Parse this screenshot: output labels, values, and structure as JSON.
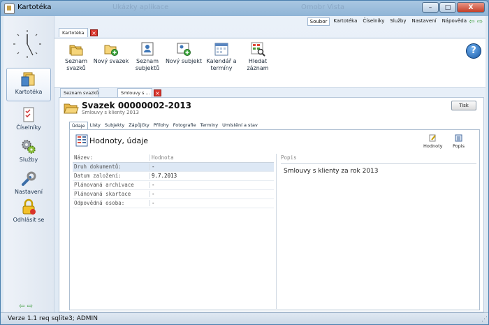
{
  "window": {
    "title": "Kartotéka",
    "ghost_title_left": "Ukázky aplikace",
    "ghost_title_right": "Omobr Vista",
    "min_label": "–",
    "max_label": "□",
    "close_label": "X"
  },
  "sidebar": {
    "items": [
      {
        "label": "Kartotéka",
        "icon": "folder-icon"
      },
      {
        "label": "Číselníky",
        "icon": "checklist-icon"
      },
      {
        "label": "Služby",
        "icon": "gears-icon"
      },
      {
        "label": "Nastavení",
        "icon": "wrench-icon"
      },
      {
        "label": "Odhlásit se",
        "icon": "lock-icon"
      }
    ],
    "arrows": "⇦ ⇨"
  },
  "menubar": {
    "items": [
      "Soubor",
      "Kartotéka",
      "Číselníky",
      "Služby",
      "Nastavení",
      "Nápověda"
    ],
    "arrows": "⇦ ⇨"
  },
  "top_tab": {
    "label": "Kartotéka",
    "close": "×"
  },
  "ribbon": {
    "buttons": [
      {
        "label": "Seznam svazků",
        "icon": "folders-icon"
      },
      {
        "label": "Nový svazek",
        "icon": "new-folder-icon"
      },
      {
        "label": "Seznam subjektů",
        "icon": "contacts-icon"
      },
      {
        "label": "Nový subjekt",
        "icon": "new-contact-icon"
      },
      {
        "label": "Kalendář a termíny",
        "icon": "calendar-icon"
      },
      {
        "label": "Hledat záznam",
        "icon": "search-grid-icon"
      }
    ],
    "help": "?"
  },
  "doc_tabs": [
    {
      "label": "Seznam svazků"
    },
    {
      "label": "Smlouvy s ..."
    }
  ],
  "doc_tab_close": "×",
  "document": {
    "title": "Svazek 00000002-2013",
    "subtitle": "Smlouvy s klienty 2013",
    "print": "Tisk",
    "subtabs": [
      "Údaje",
      "Listy",
      "Subjekty",
      "Zápůjčky",
      "Přílohy",
      "Fotografie",
      "Termíny",
      "Umístění a stav"
    ],
    "panel_title": "Hodnoty, údaje",
    "panel_buttons": [
      {
        "label": "Hodnoty",
        "icon": "edit-icon"
      },
      {
        "label": "Popis",
        "icon": "list-icon"
      }
    ],
    "table": {
      "headers": [
        "Název:",
        "Hodnota"
      ],
      "rows": [
        [
          "Druh dokumentů:",
          "-"
        ],
        [
          "Datum založení:",
          "9.7.2013"
        ],
        [
          "Plánovaná archivace",
          "-"
        ],
        [
          "Plánovaná skartace",
          "-"
        ],
        [
          "Odpovědná osoba:",
          "-"
        ]
      ]
    },
    "popis_header": "Popis",
    "popis_text": "Smlouvy s klienty za rok 2013"
  },
  "status": {
    "text": "Verze 1.1 req sqlite3; ADMIN",
    "grip": "⋰"
  }
}
